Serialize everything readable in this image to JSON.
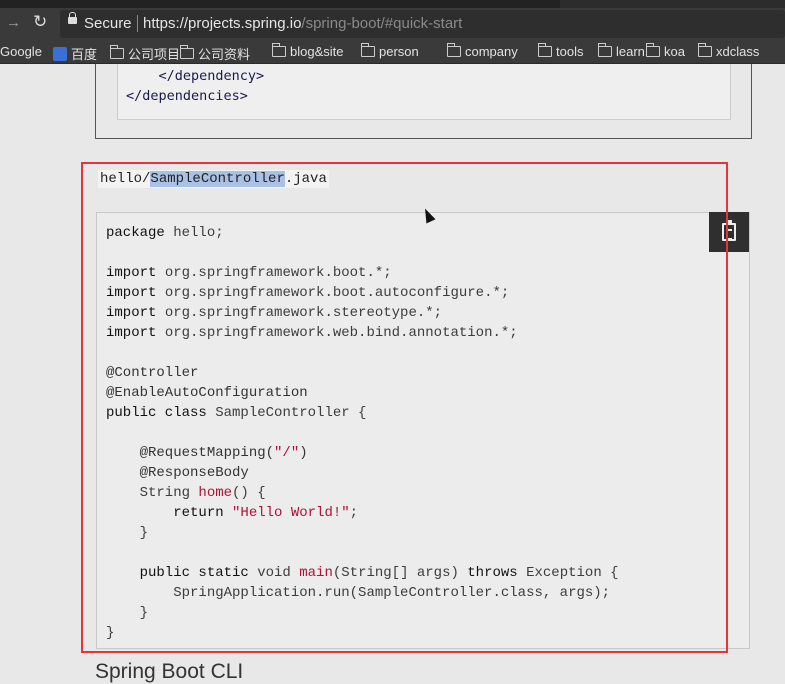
{
  "browser": {
    "secure_label": "Secure",
    "url_scheme": "https",
    "url_host": "://projects.spring.io",
    "url_path": "/spring-boot/#quick-start",
    "bookmarks": [
      {
        "label": "Google",
        "icon": "none"
      },
      {
        "label": "百度",
        "icon": "baidu-icon"
      },
      {
        "label": "公司项目",
        "icon": "folder-icon"
      },
      {
        "label": "公司资料",
        "icon": "folder-icon"
      },
      {
        "label": "blog&site",
        "icon": "folder-icon"
      },
      {
        "label": "person",
        "icon": "folder-icon"
      },
      {
        "label": "company",
        "icon": "folder-icon"
      },
      {
        "label": "tools",
        "icon": "folder-icon"
      },
      {
        "label": "learn",
        "icon": "folder-icon"
      },
      {
        "label": "koa",
        "icon": "folder-icon"
      },
      {
        "label": "xdclass",
        "icon": "folder-icon"
      }
    ]
  },
  "upper_code": [
    "    </dependency>",
    "</dependencies>"
  ],
  "file": {
    "prefix": "hello/",
    "selected": "SampleController",
    "suffix": ".java"
  },
  "code": [
    [
      [
        "kw",
        "package"
      ],
      [
        "id",
        " hello;"
      ]
    ],
    [],
    [
      [
        "kw",
        "import"
      ],
      [
        "id",
        " org.springframework.boot.*;"
      ]
    ],
    [
      [
        "kw",
        "import"
      ],
      [
        "id",
        " org.springframework.boot.autoconfigure.*;"
      ]
    ],
    [
      [
        "kw",
        "import"
      ],
      [
        "id",
        " org.springframework.stereotype.*;"
      ]
    ],
    [
      [
        "kw",
        "import"
      ],
      [
        "id",
        " org.springframework.web.bind.annotation.*;"
      ]
    ],
    [],
    [
      [
        "an",
        "@Controller"
      ]
    ],
    [
      [
        "an",
        "@EnableAutoConfiguration"
      ]
    ],
    [
      [
        "kw",
        "public class"
      ],
      [
        "id",
        " SampleController {"
      ]
    ],
    [],
    [
      [
        "an",
        "    @RequestMapping("
      ],
      [
        "str",
        "\"/\""
      ],
      [
        "an",
        ")"
      ]
    ],
    [
      [
        "an",
        "    @ResponseBody"
      ]
    ],
    [
      [
        "id",
        "    String "
      ],
      [
        "fn",
        "home"
      ],
      [
        "id",
        "() {"
      ]
    ],
    [
      [
        "kw",
        "        return "
      ],
      [
        "str",
        "\"Hello World!\""
      ],
      [
        "id",
        ";"
      ]
    ],
    [
      [
        "id",
        "    }"
      ]
    ],
    [],
    [
      [
        "kw",
        "    public static"
      ],
      [
        "id",
        " void "
      ],
      [
        "fn",
        "main"
      ],
      [
        "id",
        "(String[] args) "
      ],
      [
        "kw",
        "throws"
      ],
      [
        "id",
        " Exception {"
      ]
    ],
    [
      [
        "id",
        "        SpringApplication.run(SampleController.class, args);"
      ]
    ],
    [
      [
        "id",
        "    }"
      ]
    ],
    [
      [
        "id",
        "}"
      ]
    ]
  ],
  "next_heading": "Spring Boot CLI",
  "colors": {
    "highlight": "#e8333b",
    "selection": "#a9c1e4",
    "string": "#b0103a"
  }
}
